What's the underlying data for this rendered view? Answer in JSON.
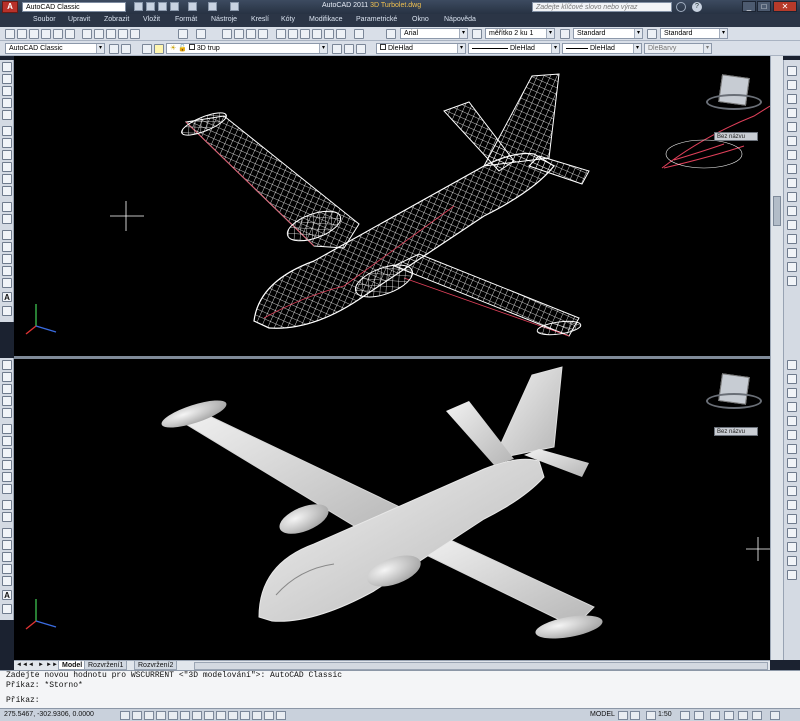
{
  "titlebar": {
    "workspace": "AutoCAD Classic",
    "app_title": "AutoCAD 2011",
    "file_title": "3D Turbolet.dwg",
    "search_placeholder": "Zadejte klíčové slovo nebo výraz"
  },
  "menubar": {
    "items": [
      "Soubor",
      "Upravit",
      "Zobrazit",
      "Vložit",
      "Formát",
      "Nástroje",
      "Kreslí",
      "Kóty",
      "Modifikace",
      "Parametrické",
      "Okno",
      "Nápověda"
    ]
  },
  "toolbar1": {
    "font": "Arial",
    "scale": "měřítko 2 ku 1",
    "text_style": "Standard",
    "table_style": "Standard"
  },
  "toolbar2": {
    "workspace": "AutoCAD Classic",
    "layer": "3D trup",
    "color": "DleHlad",
    "linetype": "DleHlad",
    "lineweight": "DleHlad",
    "plotstyle": "DleBarvy"
  },
  "viewcube": {
    "top_label": "Bez názvu",
    "bottom_label": "Bez názvu"
  },
  "tabs": [
    "Model",
    "Rozvržení1",
    "Rozvržení2"
  ],
  "command": {
    "line1": "Zadejte novou hodnotu pro WSCURRENT <\"3D modelování\">: AutoCAD Classic",
    "line2": "Příkaz: *Storno*",
    "line3": "Příkaz:"
  },
  "status": {
    "coords": "275.5467, -302.9306, 0.0000",
    "model": "MODEL",
    "scale": "1:50"
  },
  "colors": {
    "viewport_bg": "#000000",
    "wireframe": "#ffffff",
    "wire_accent": "#e0405a",
    "title_accent": "#f0c050"
  }
}
